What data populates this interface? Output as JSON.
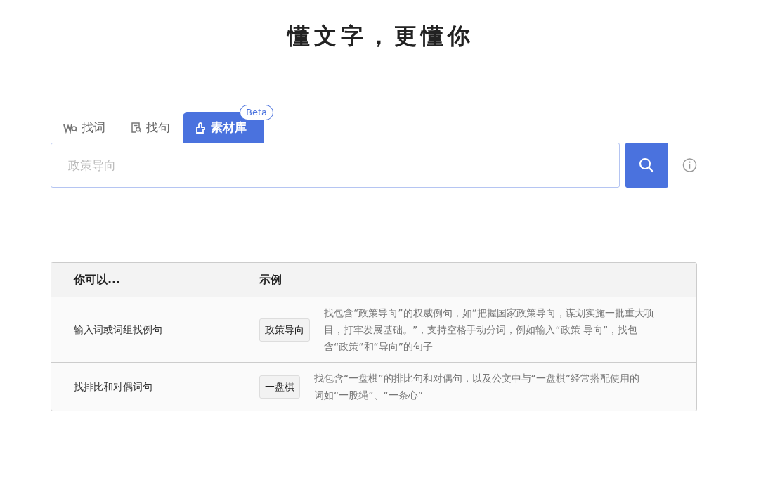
{
  "title": "懂文字，更懂你",
  "tabs": [
    {
      "kind": "word",
      "label": "找词",
      "selected": false
    },
    {
      "kind": "sentence",
      "label": "找句",
      "selected": false
    },
    {
      "kind": "material",
      "label": "素材库",
      "selected": true,
      "badge": "Beta"
    }
  ],
  "search": {
    "placeholder": "政策导向"
  },
  "table": {
    "columns": [
      "你可以...",
      "示例"
    ],
    "rows": [
      {
        "action": "输入词或词组找例句",
        "example": "政策导向",
        "description": "找包含“政策导向”的权威例句，如“把握国家政策导向，谋划实施一批重大项目，打牢发展基础。”，支持空格手动分词，例如输入“政策 导向”，找包含“政策”和“导向”的句子"
      },
      {
        "action": "找排比和对偶词句",
        "example": "一盘棋",
        "description": "找包含“一盘棋”的排比句和对偶句，以及公文中与“一盘棋”经常搭配使用的词如“一股绳”、“一条心”"
      }
    ]
  }
}
